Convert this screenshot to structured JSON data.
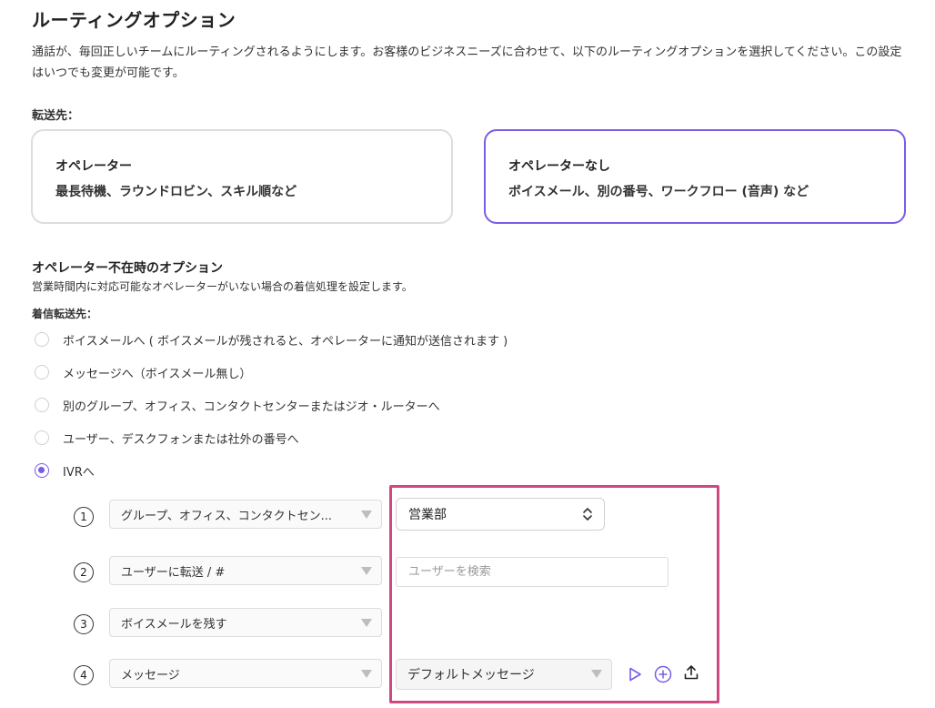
{
  "page": {
    "title": "ルーティングオプション",
    "description": "通話が、毎回正しいチームにルーティングされるようにします。お客様のビジネスニーズに合わせて、以下のルーティングオプションを選択してください。この設定はいつでも変更が可能です。"
  },
  "forward_to": {
    "label": "転送先：",
    "cards": [
      {
        "title": "オペレーター",
        "desc": "最長待機、ラウンドロビン、スキル順など",
        "selected": false
      },
      {
        "title": "オペレーターなし",
        "desc": "ボイスメール、別の番号、ワークフロー (音声) など",
        "selected": true
      }
    ]
  },
  "no_operator": {
    "heading": "オペレーター不在時のオプション",
    "desc": "営業時間内に対応可能なオペレーターがいない場合の着信処理を設定します。",
    "forward_label": "着信転送先：",
    "options": [
      {
        "label": "ボイスメールへ ( ボイスメールが残されると、オペレーターに通知が送信されます )",
        "checked": false
      },
      {
        "label": "メッセージへ（ボイスメール無し）",
        "checked": false
      },
      {
        "label": "別のグループ、オフィス、コンタクトセンターまたはジオ・ルーターへ",
        "checked": false
      },
      {
        "label": "ユーザー、デスクフォンまたは社外の番号へ",
        "checked": false
      },
      {
        "label": "IVRへ",
        "checked": true
      }
    ]
  },
  "ivr": {
    "steps": [
      {
        "num": "1",
        "action": "グループ、オフィス、コンタクトセン..."
      },
      {
        "num": "2",
        "action": "ユーザーに転送 / #"
      },
      {
        "num": "3",
        "action": "ボイスメールを残す"
      },
      {
        "num": "4",
        "action": "メッセージ"
      }
    ],
    "group_value": "営業部",
    "user_search_placeholder": "ユーザーを検索",
    "message_value": "デフォルトメッセージ"
  },
  "colors": {
    "accent": "#7a5ce6",
    "highlight": "#d04880"
  }
}
